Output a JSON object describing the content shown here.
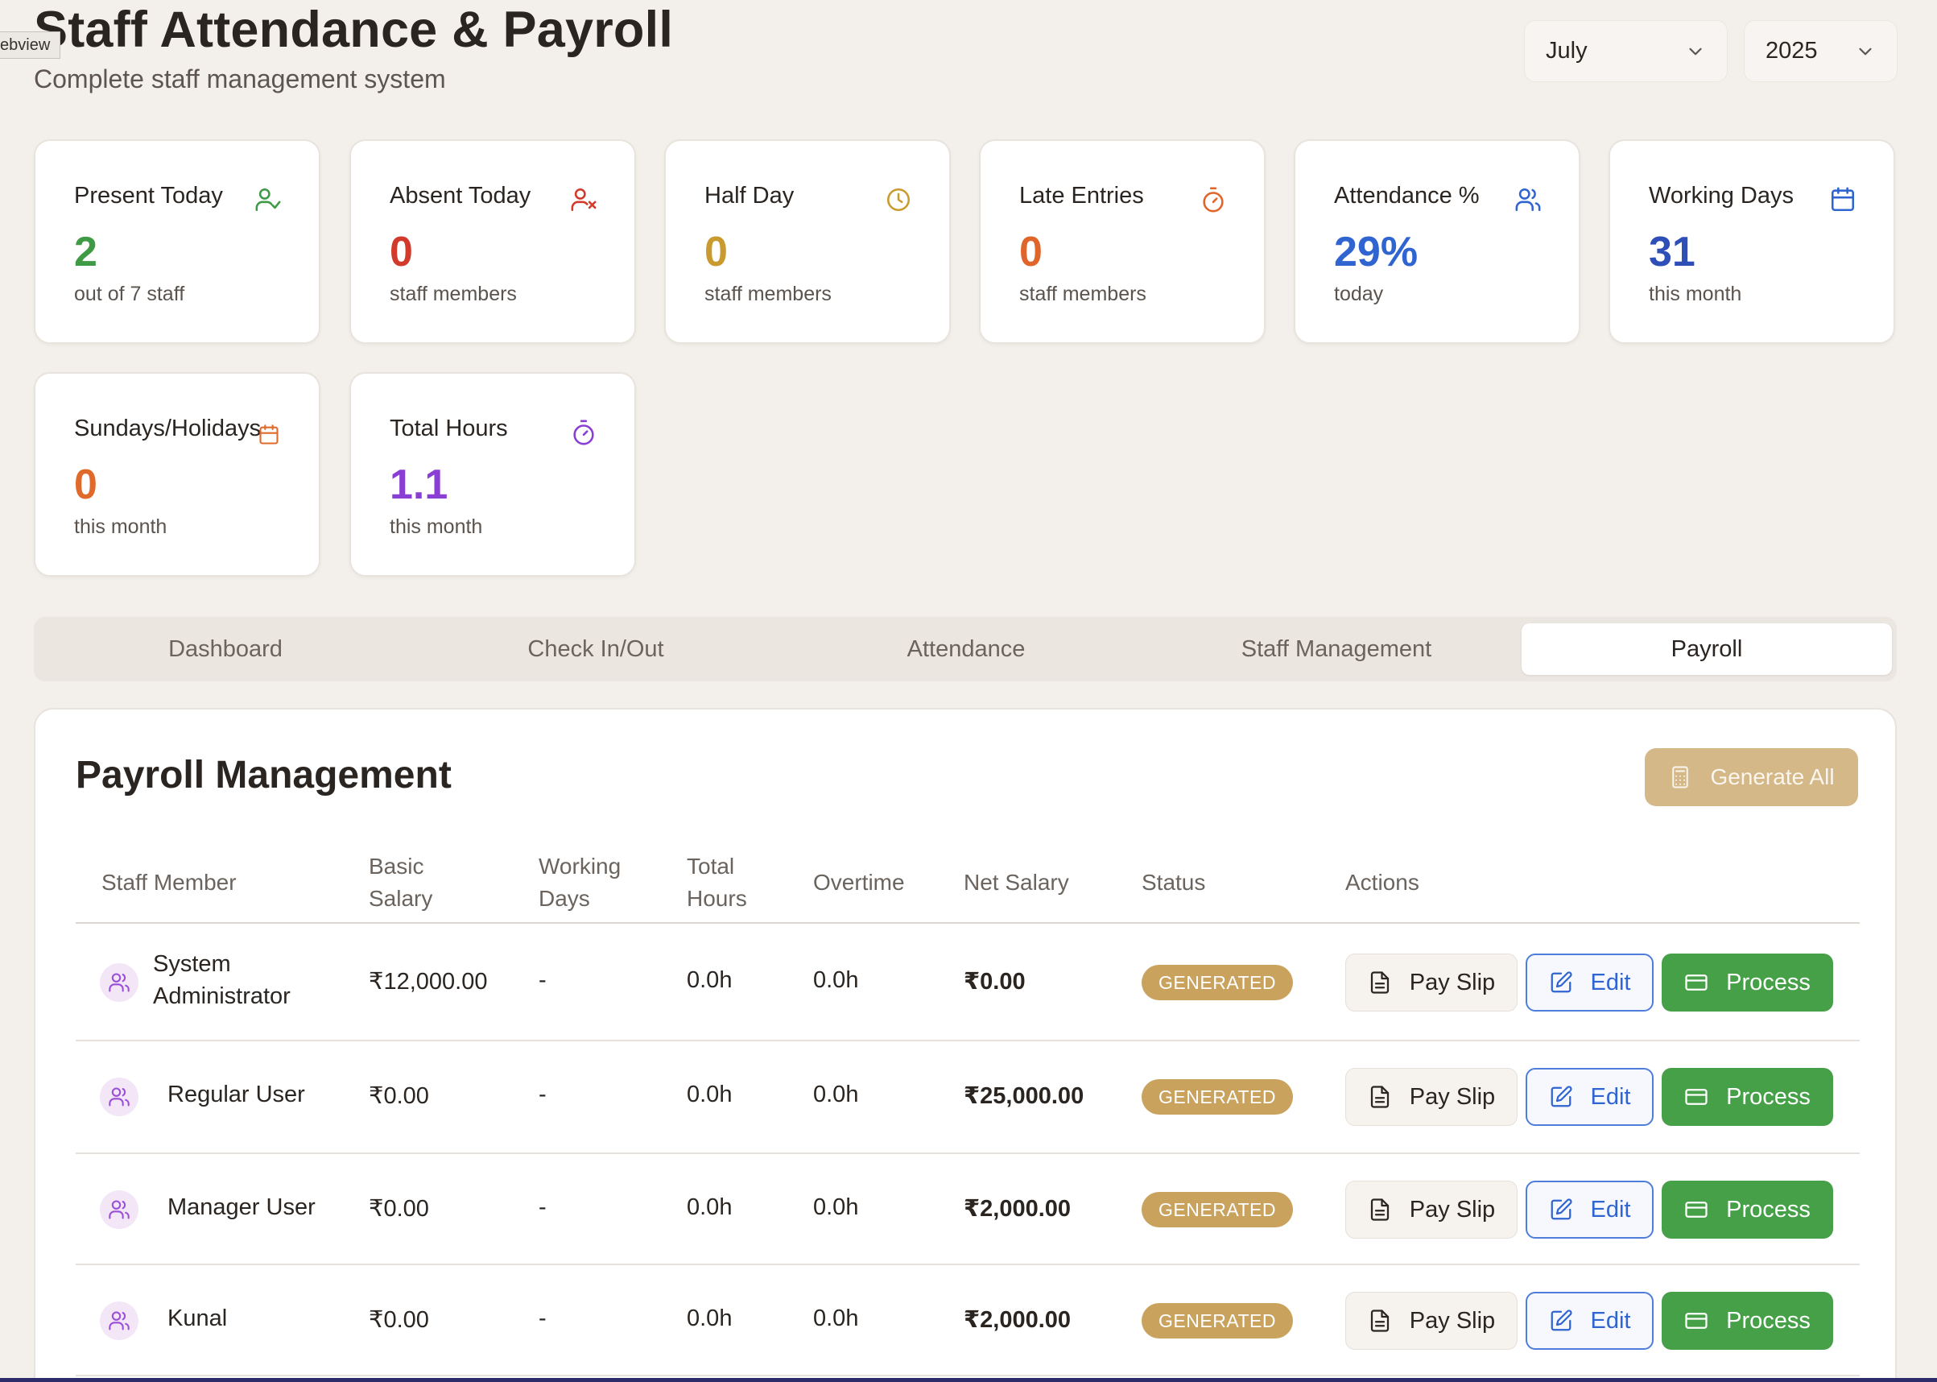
{
  "webview_label": "ebview",
  "header": {
    "title": "Staff Attendance & Payroll",
    "subtitle": "Complete staff management system",
    "month_select": "July",
    "year_select": "2025"
  },
  "stats": [
    {
      "label": "Present Today",
      "value": "2",
      "sub": "out of 7 staff",
      "color": "#3f9a45",
      "icon": "user-check-icon"
    },
    {
      "label": "Absent Today",
      "value": "0",
      "sub": "staff members",
      "color": "#d23a2c",
      "icon": "user-x-icon"
    },
    {
      "label": "Half Day",
      "value": "0",
      "sub": "staff members",
      "color": "#c99a2e",
      "icon": "clock-icon"
    },
    {
      "label": "Late Entries",
      "value": "0",
      "sub": "staff members",
      "color": "#e0652a",
      "icon": "timer-icon"
    },
    {
      "label": "Attendance %",
      "value": "29%",
      "sub": "today",
      "color": "#2f64d1",
      "icon": "users-icon"
    },
    {
      "label": "Working Days",
      "value": "31",
      "sub": "this month",
      "color": "#2f4fb8",
      "icon": "calendar-icon"
    },
    {
      "label": "Sundays/Holidays",
      "value": "0",
      "sub": "this month",
      "color": "#e06a2a",
      "icon": "calendar-icon"
    },
    {
      "label": "Total Hours",
      "value": "1.1",
      "sub": "this month",
      "color": "#8a3fd4",
      "icon": "timer-icon"
    }
  ],
  "tabs": [
    "Dashboard",
    "Check In/Out",
    "Attendance",
    "Staff Management",
    "Payroll"
  ],
  "active_tab": "Payroll",
  "payroll": {
    "title": "Payroll Management",
    "generate_all_label": "Generate All",
    "columns": {
      "staff_member": "Staff Member",
      "basic_salary_1": "Basic",
      "basic_salary_2": "Salary",
      "working_days_1": "Working",
      "working_days_2": "Days",
      "total_hours_1": "Total",
      "total_hours_2": "Hours",
      "overtime": "Overtime",
      "net_salary": "Net Salary",
      "status": "Status",
      "actions": "Actions"
    },
    "rows": [
      {
        "name_1": "System",
        "name_2": "Administrator",
        "basic": "₹12,000.00",
        "days": "-",
        "hours": "0.0h",
        "overtime": "0.0h",
        "net": "₹0.00",
        "status": "GENERATED"
      },
      {
        "name_1": "Regular User",
        "name_2": "",
        "basic": "₹0.00",
        "days": "-",
        "hours": "0.0h",
        "overtime": "0.0h",
        "net": "₹25,000.00",
        "status": "GENERATED"
      },
      {
        "name_1": "Manager User",
        "name_2": "",
        "basic": "₹0.00",
        "days": "-",
        "hours": "0.0h",
        "overtime": "0.0h",
        "net": "₹2,000.00",
        "status": "GENERATED"
      },
      {
        "name_1": "Kunal",
        "name_2": "",
        "basic": "₹0.00",
        "days": "-",
        "hours": "0.0h",
        "overtime": "0.0h",
        "net": "₹2,000.00",
        "status": "GENERATED"
      }
    ],
    "action_labels": {
      "payslip": "Pay Slip",
      "edit": "Edit",
      "process": "Process"
    }
  }
}
